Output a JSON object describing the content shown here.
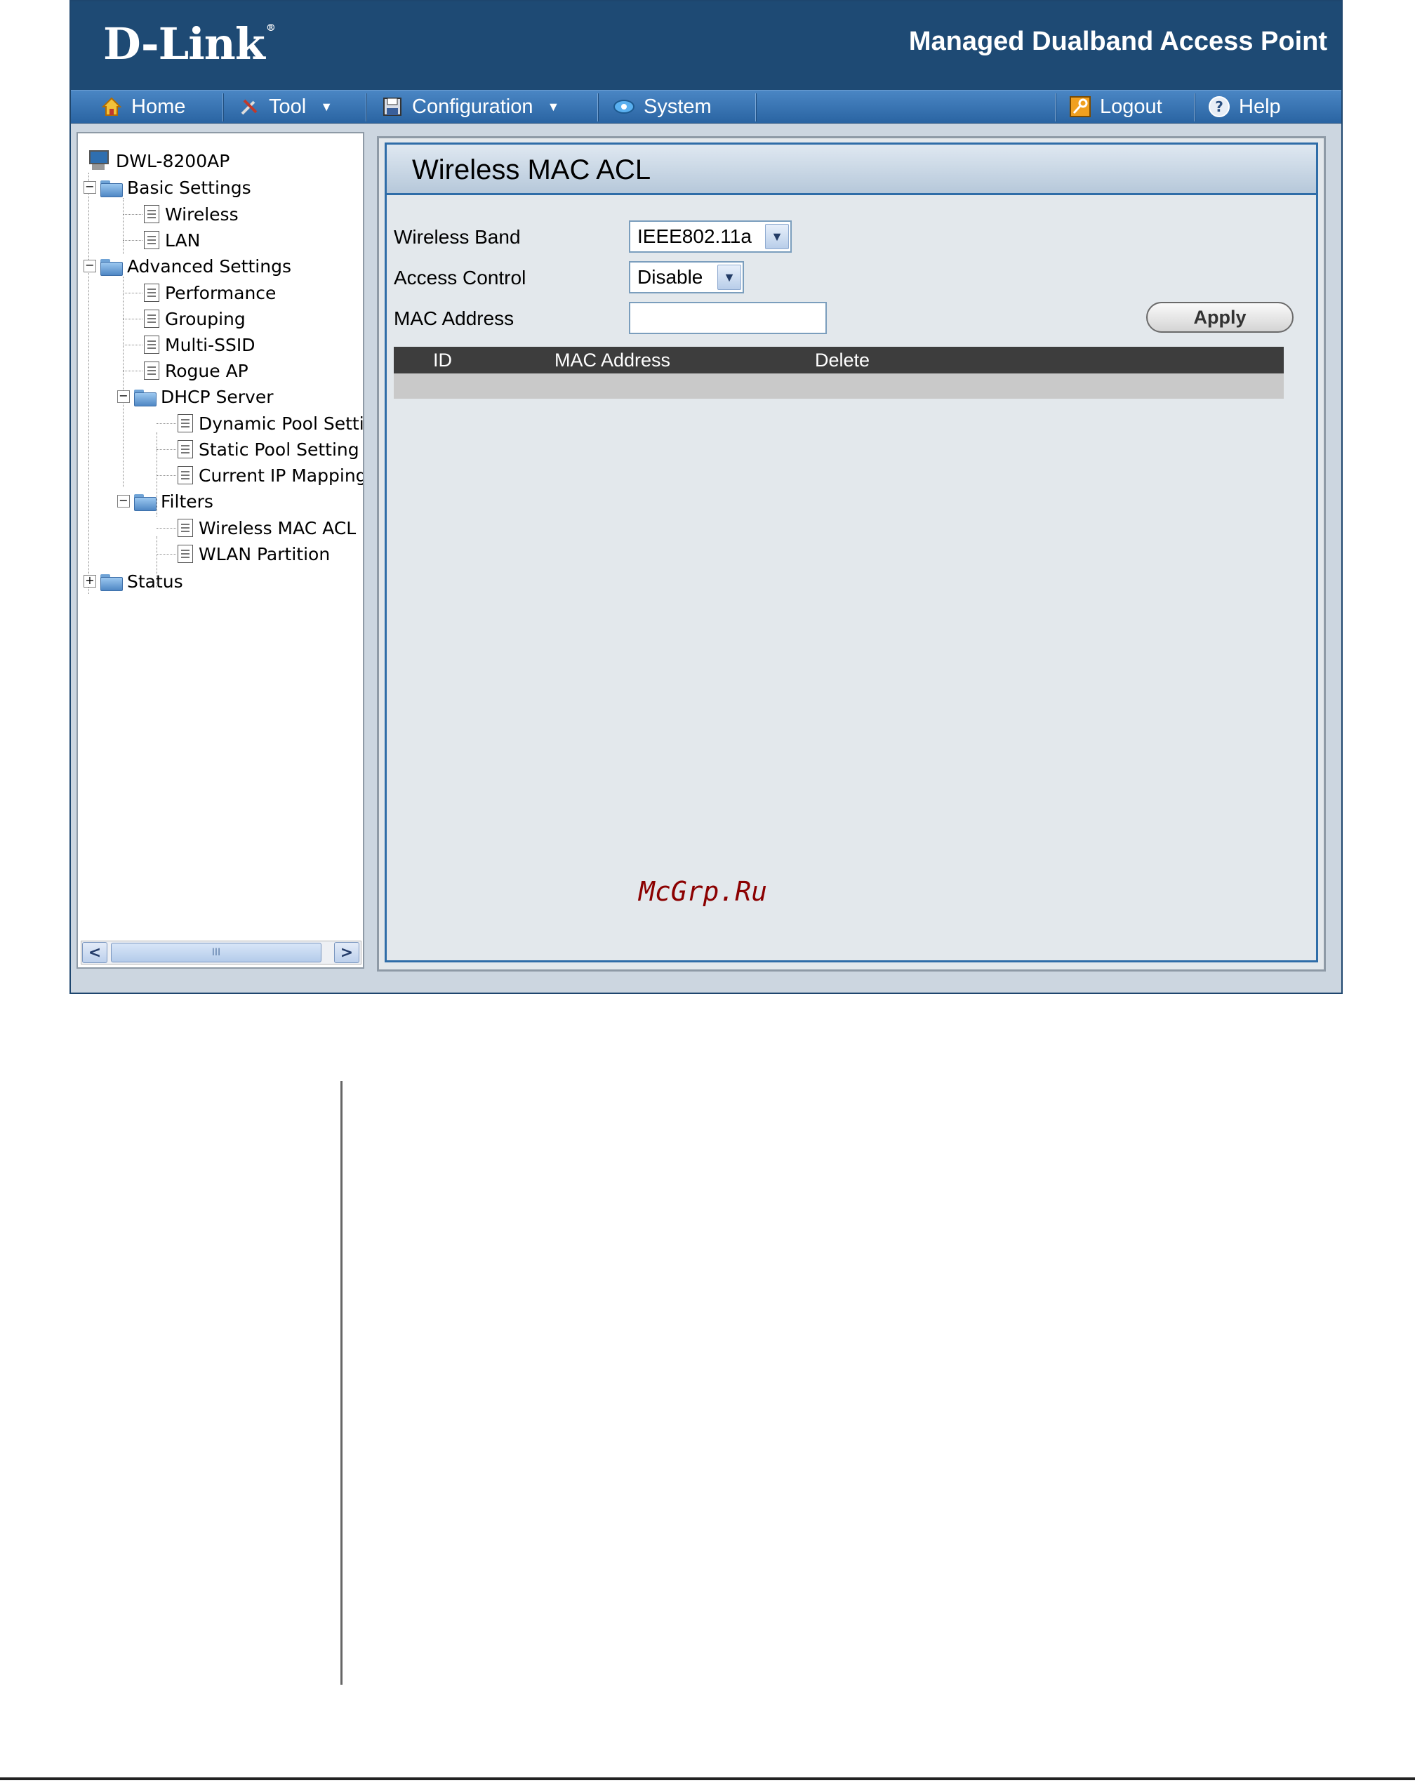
{
  "header": {
    "brand": "D-Link",
    "brand_mark": "®",
    "product_title": "Managed Dualband Access Point"
  },
  "menu": {
    "home": "Home",
    "tool": "Tool",
    "configuration": "Configuration",
    "system": "System",
    "logout": "Logout",
    "help": "Help"
  },
  "tree": {
    "root": "DWL-8200AP",
    "basic_settings": "Basic Settings",
    "wireless": "Wireless",
    "lan": "LAN",
    "advanced_settings": "Advanced Settings",
    "performance": "Performance",
    "grouping": "Grouping",
    "multi_ssid": "Multi-SSID",
    "rogue_ap": "Rogue AP",
    "dhcp_server": "DHCP Server",
    "dynamic_pool": "Dynamic Pool Setting",
    "static_pool": "Static Pool Setting",
    "current_ip": "Current IP Mapping L",
    "filters": "Filters",
    "wireless_mac_acl": "Wireless MAC ACL",
    "wlan_partition": "WLAN Partition",
    "status": "Status",
    "expanded_symbol": "−",
    "collapsed_symbol": "+"
  },
  "scrollbar": {
    "left": "<",
    "right": ">",
    "thumb_grip": "III"
  },
  "content": {
    "title": "Wireless MAC ACL",
    "wireless_band_label": "Wireless Band",
    "wireless_band_value": "IEEE802.11a",
    "access_control_label": "Access Control",
    "access_control_value": "Disable",
    "mac_address_label": "MAC Address",
    "mac_address_value": "",
    "apply_label": "Apply",
    "table_headers": {
      "id": "ID",
      "mac_address": "MAC Address",
      "delete": "Delete"
    }
  },
  "watermark": "McGrp.Ru",
  "colors": {
    "header_bg": "#1e4a74",
    "menubar": "#2f6aa8",
    "panel_border": "#2f6da8",
    "table_header": "#3d3d3d"
  }
}
